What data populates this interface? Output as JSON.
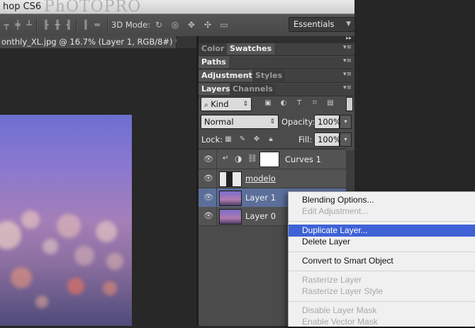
{
  "window": {
    "title": "hop CS6",
    "watermark": "PhOTOPRO"
  },
  "options_bar": {
    "mode_label": "3D Mode:",
    "workspace": "Essentials"
  },
  "document": {
    "tab_label": "onthly_XL.jpg @ 16.7% (Layer 1, RGB/8#) *"
  },
  "panels": {
    "group1": {
      "tabs": [
        "Color",
        "Swatches"
      ],
      "active": "Swatches"
    },
    "group2": {
      "tabs": [
        "Paths"
      ]
    },
    "group3": {
      "tabs": [
        "Adjustments",
        "Styles"
      ],
      "active": "Adjustments"
    },
    "group4": {
      "tabs": [
        "Layers",
        "Channels"
      ],
      "active": "Layers"
    }
  },
  "layers_panel": {
    "filter_label": "Kind",
    "blend_mode": "Normal",
    "opacity_label": "Opacity:",
    "opacity_value": "100%",
    "lock_label": "Lock:",
    "fill_label": "Fill:",
    "fill_value": "100%",
    "layers": [
      {
        "name": "Curves 1",
        "type": "adjustment",
        "visible": true
      },
      {
        "name": "modelo",
        "type": "smart",
        "visible": true
      },
      {
        "name": "Layer 1",
        "type": "pixel",
        "visible": true,
        "selected": true
      },
      {
        "name": "Layer 0",
        "type": "pixel",
        "visible": true
      }
    ]
  },
  "context_menu": {
    "items": [
      {
        "label": "Blending Options...",
        "enabled": true
      },
      {
        "label": "Edit Adjustment...",
        "enabled": false
      },
      {
        "label": "Duplicate Layer...",
        "enabled": true,
        "highlighted": true
      },
      {
        "label": "Delete Layer",
        "enabled": true
      },
      {
        "label": "Convert to Smart Object",
        "enabled": true
      },
      {
        "label": "Rasterize Layer",
        "enabled": false
      },
      {
        "label": "Rasterize Layer Style",
        "enabled": false
      },
      {
        "label": "Disable Layer Mask",
        "enabled": false
      },
      {
        "label": "Enable Vector Mask",
        "enabled": false
      }
    ]
  },
  "colors": {
    "menu_highlight": "#3f62d6",
    "selected_layer": "#5b6f9a",
    "panel_bg": "#4b4b4b"
  }
}
